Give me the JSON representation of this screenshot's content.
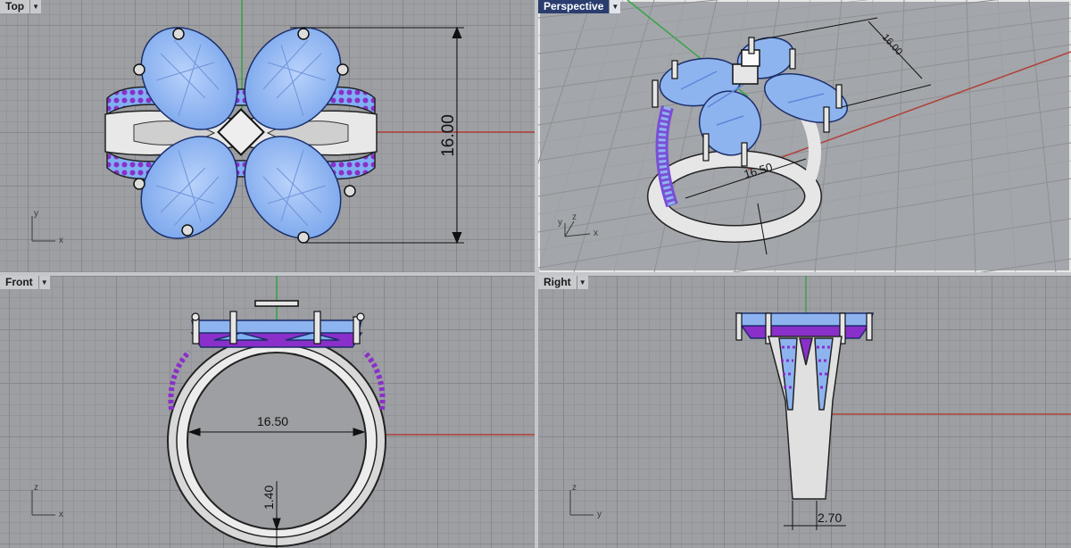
{
  "viewports": {
    "top": {
      "label": "Top",
      "dimension": "16.00",
      "axes": {
        "vertical": "y",
        "horizontal": "x"
      }
    },
    "perspective": {
      "label": "Perspective",
      "dimension_top": "16.00",
      "dimension_bottom": "16.50",
      "axes": {
        "first": "y",
        "second": "z",
        "third": "x"
      }
    },
    "front": {
      "label": "Front",
      "dimension_width": "16.50",
      "dimension_height": "1.40",
      "axes": {
        "vertical": "z",
        "horizontal": "x"
      }
    },
    "right": {
      "label": "Right",
      "dimension_width": "2.70",
      "axes": {
        "vertical": "z",
        "horizontal": "y"
      }
    }
  },
  "colors": {
    "gem": "#8eb4f0",
    "gem_facet": "#5e86d6",
    "pave": "#8a2fc9",
    "metal": "#e6e6e6",
    "x_axis": "#b0413a",
    "y_axis": "#3aa34a"
  },
  "icons": {
    "dropdown": "chevron-down-icon"
  }
}
